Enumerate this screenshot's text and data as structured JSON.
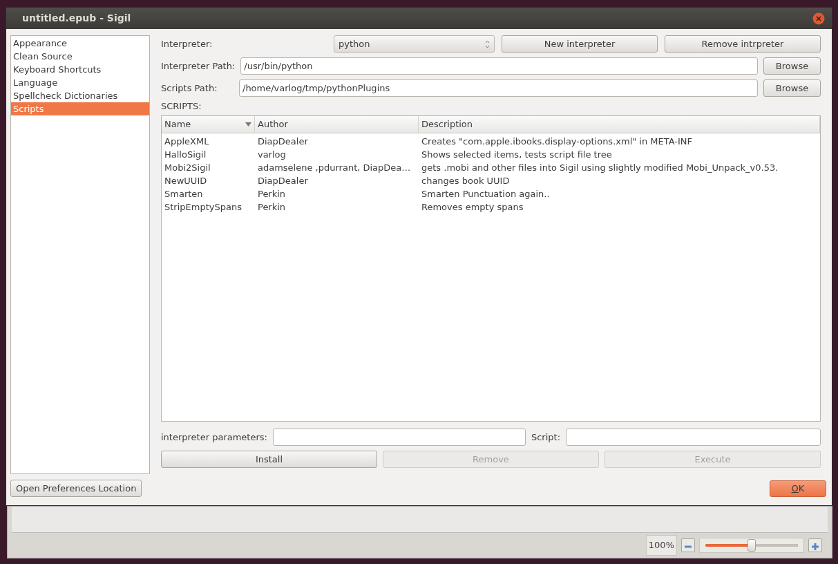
{
  "window": {
    "title": "untitled.epub - Sigil"
  },
  "sidebar": {
    "items": [
      {
        "label": "Appearance",
        "selected": false
      },
      {
        "label": "Clean Source",
        "selected": false
      },
      {
        "label": "Keyboard Shortcuts",
        "selected": false
      },
      {
        "label": "Language",
        "selected": false
      },
      {
        "label": "Spellcheck Dictionaries",
        "selected": false
      },
      {
        "label": "Scripts",
        "selected": true
      }
    ],
    "button": "Open Preferences Location"
  },
  "interpreter": {
    "label": "Interpreter:",
    "value": "python",
    "buttons": [
      "New interpreter",
      "Remove intrpreter"
    ]
  },
  "interpreter_path": {
    "label": "Interpreter Path:",
    "value": "/usr/bin/python",
    "button": "Browse"
  },
  "scripts_path": {
    "label": "Scripts Path:",
    "value": "/home/varlog/tmp/pythonPlugins",
    "button": "Browse"
  },
  "scripts_label": "SCRIPTS:",
  "table": {
    "columns": [
      {
        "label": "Name",
        "sorted": true
      },
      {
        "label": "Author",
        "sorted": false
      },
      {
        "label": "Description",
        "sorted": false
      }
    ],
    "rows": [
      [
        "AppleXML",
        "DiapDealer",
        "Creates \"com.apple.ibooks.display-options.xml\" in META-INF"
      ],
      [
        "HalloSigil",
        "varlog",
        "Shows selected items, tests script file tree"
      ],
      [
        "Mobi2Sigil",
        "adamselene ,pdurrant, DiapDea…",
        "gets .mobi and other files into Sigil using slightly modified Mobi_Unpack_v0.53."
      ],
      [
        "NewUUID",
        "DiapDealer",
        "changes book UUID"
      ],
      [
        "Smarten",
        "Perkin",
        "Smarten Punctuation again.."
      ],
      [
        "StripEmptySpans",
        "Perkin",
        "Removes empty spans"
      ]
    ]
  },
  "params": {
    "label": "interpreter parameters:"
  },
  "script": {
    "label": "Script:"
  },
  "actions": [
    {
      "label": "Install",
      "disabled": false
    },
    {
      "label": "Remove",
      "disabled": true
    },
    {
      "label": "Execute",
      "disabled": true
    }
  ],
  "ok_button": "OK",
  "status_bar": {
    "zoom": "100%",
    "level": 0.5
  }
}
